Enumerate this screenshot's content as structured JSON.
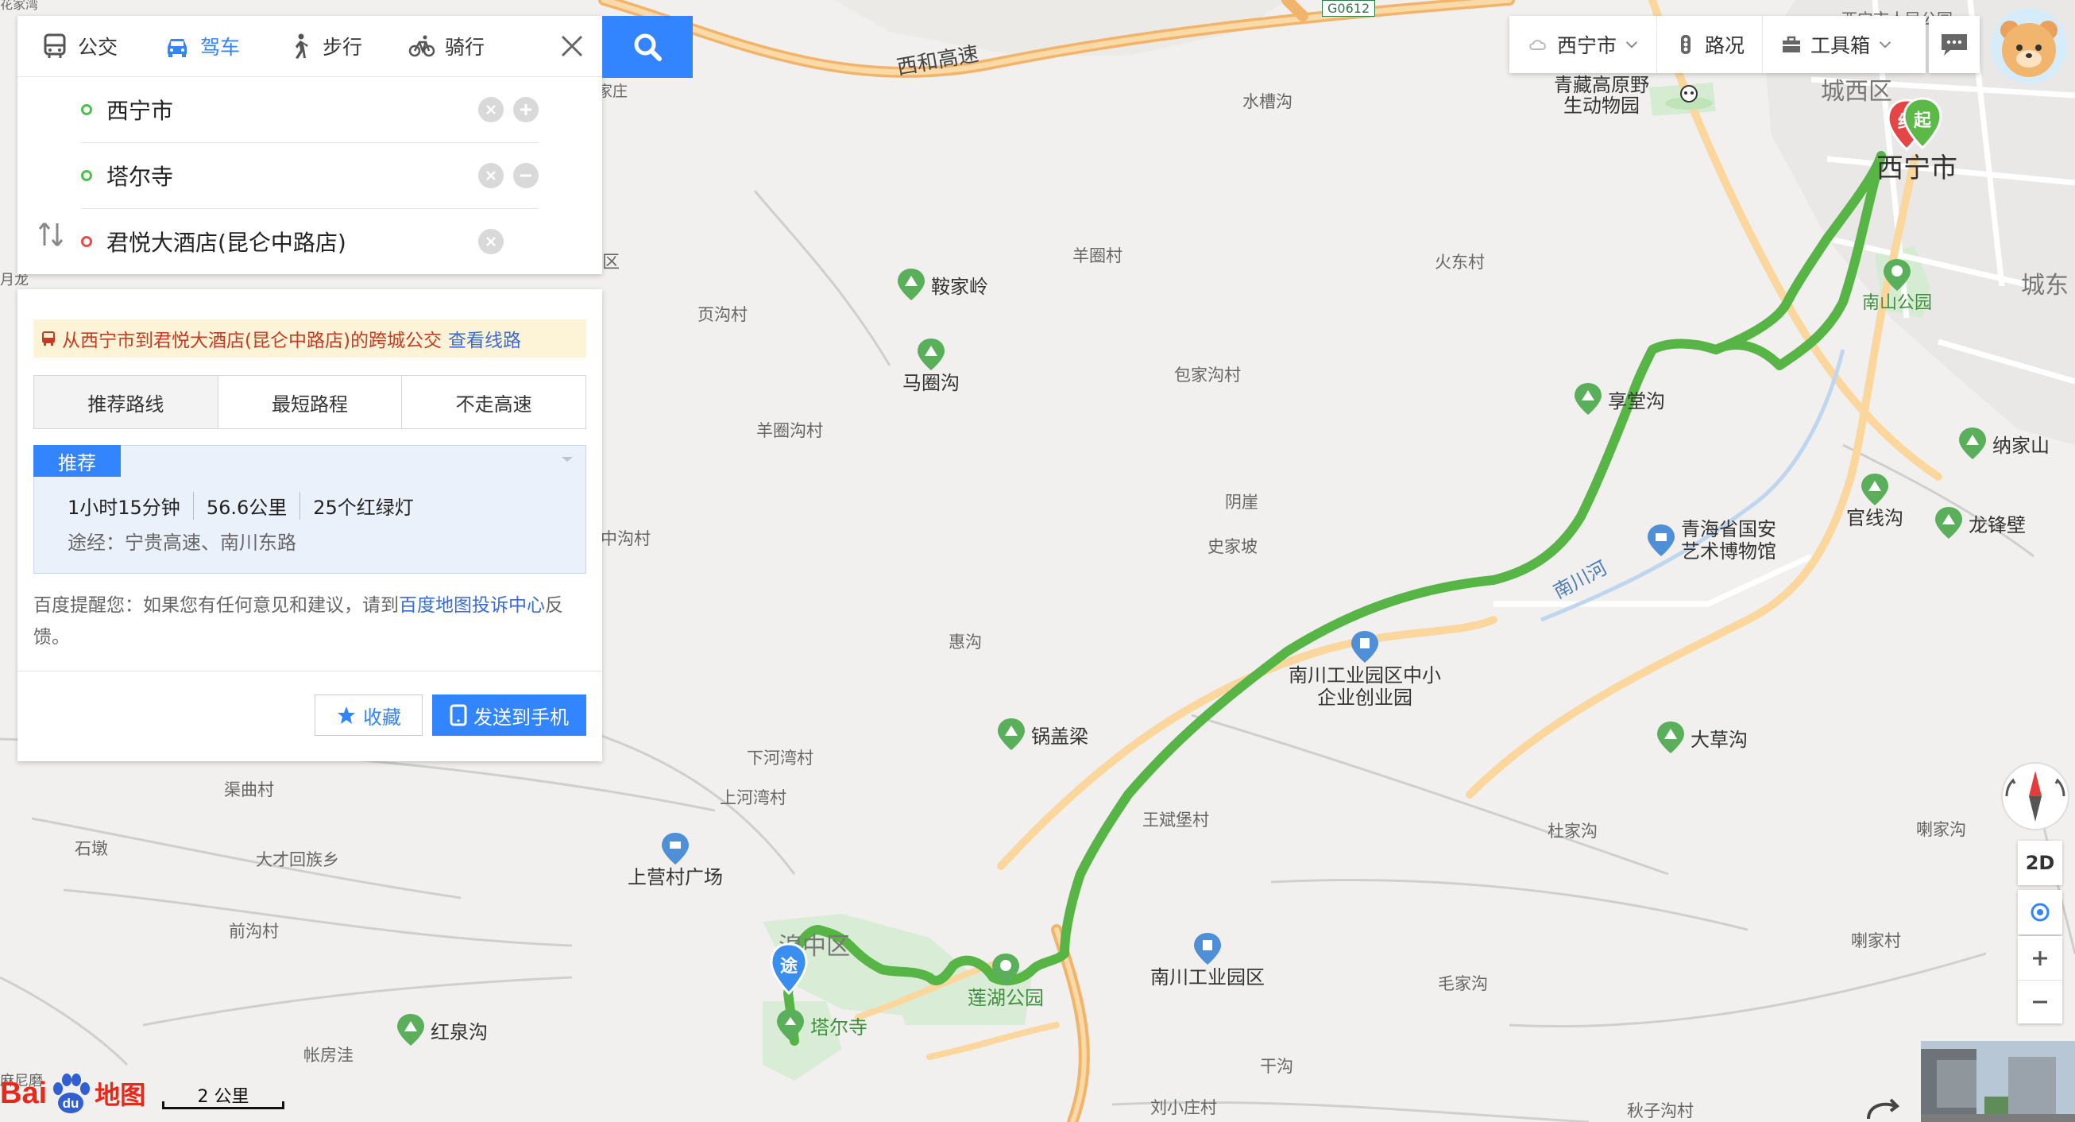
{
  "mode_tabs": [
    {
      "label": "公交",
      "icon": "bus-icon"
    },
    {
      "label": "驾车",
      "icon": "car-icon",
      "active": true
    },
    {
      "label": "步行",
      "icon": "walk-icon"
    },
    {
      "label": "骑行",
      "icon": "bike-icon"
    }
  ],
  "route": {
    "start": "西宁市",
    "waypoint": "塔尔寺",
    "end": "君悦大酒店(昆仑中路店)"
  },
  "notice": {
    "text": "从西宁市到君悦大酒店(昆仑中路店)的跨城公交",
    "link": "查看线路"
  },
  "pref_tabs": [
    "推荐路线",
    "最短路程",
    "不走高速"
  ],
  "plan": {
    "tag": "推荐",
    "time": "1小时15分钟",
    "distance": "56.6公里",
    "lights": "25个红绿灯",
    "via": "途经：宁贵高速、南川东路"
  },
  "advice": {
    "prefix": "百度提醒您：如果您有任何意见和建议，请到",
    "link": "百度地图投诉中心",
    "suffix": "反馈。"
  },
  "actions": {
    "favorite": "收藏",
    "send": "发送到手机"
  },
  "toolbar": {
    "city": "西宁市",
    "traffic": "路况",
    "tools": "工具箱"
  },
  "controls": {
    "view_mode": "2D"
  },
  "scale_label": "2 公里",
  "logo": {
    "bai": "Bai",
    "du": "du",
    "ditu": "地图"
  },
  "map_labels": {
    "road_g0612": "G0612",
    "xihe_highway": "西和高速",
    "nanchuan_river": "南川河",
    "district_chengxi": "城西区",
    "district_chengdong": "城东",
    "district_huangzhong": "湟中区",
    "xining_city": "西宁市",
    "shuicaogou": "水槽沟",
    "yangquancun": "羊圈村",
    "huodongcun": "火东村",
    "yehucun": "页沟村",
    "baojiagoucun": "包家沟村",
    "yangquangoucun": "羊圈沟村",
    "yinya": "阴崖",
    "shijiapo": "史家坡",
    "zhonggoucun": "中沟村",
    "huigou": "惠沟",
    "xiahewancun": "下河湾村",
    "shanghewancun": "上河湾村",
    "quqicun": "渠曲村",
    "shidun": "石墩",
    "dacaihuizuxiang": "大才回族乡",
    "qiangoucun": "前沟村",
    "zhangfangwa": "帐房洼",
    "wangbinpucun": "王斌堡村",
    "dujiagou": "杜家沟",
    "lajiagou": "喇家沟",
    "laojiacun": "喇家村",
    "maojiagou": "毛家沟",
    "gangou": "干沟",
    "liuxiaozhuangcun": "刘小庄村",
    "qiuzigoucun": "秋子沟村",
    "manigou": "麻尼磨",
    "xiyuehuang": "月龙",
    "jiazhuang": "家庄",
    "xining_people_park": "西宁市人民公园",
    "qu_left": "区",
    "top_left_edge": "花家湾"
  },
  "pois": {
    "anjialing": "鞍家岭",
    "majuangou": "马圈沟",
    "xiangtanggou": "享堂沟",
    "nanshan_park": "南山公园",
    "najiashan": "纳家山",
    "guanxiangou": "官线沟",
    "longfengbi": "龙锋壁",
    "qinghai_museum": "青海省国安艺术博物馆",
    "nanchuan_sme": "南川工业园区中小企业创业园",
    "guogailiang": "锅盖梁",
    "dacaogou": "大草沟",
    "shangying_square": "上营村广场",
    "nanchuan_industrial": "南川工业园区",
    "lianhu_park": "莲湖公园",
    "taersi": "塔尔寺",
    "hongquangou": "红泉沟",
    "qingzang_zoo": "青藏高原野生动物园"
  },
  "markers": {
    "start": "起",
    "end": "终",
    "via": "途"
  },
  "colors": {
    "route": "#4fb83f",
    "highway": "#f2b36a",
    "accent": "#3385ff",
    "poi_green": "#4fa84f",
    "poi_blue": "#4f8fd8",
    "start_marker": "#5bb948",
    "end_marker": "#e64545"
  }
}
